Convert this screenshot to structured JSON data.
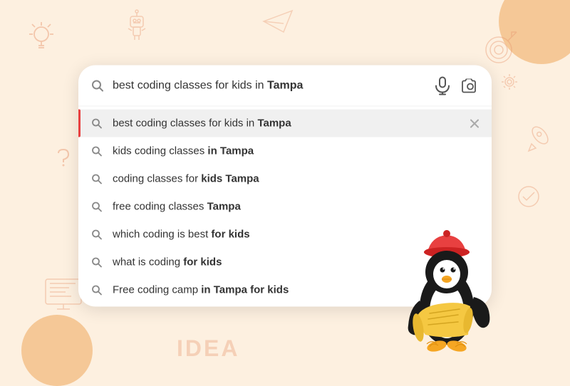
{
  "search": {
    "main_query_text": "best coding classes for kids in ",
    "main_query_bold": "Tampa",
    "mic_aria": "Voice search",
    "camera_aria": "Search by image"
  },
  "suggestions": [
    {
      "id": "s1",
      "text_normal": "best coding classes for kids in ",
      "text_bold": "Tampa",
      "active": true,
      "show_close": true
    },
    {
      "id": "s2",
      "text_normal": "kids coding classes ",
      "text_bold": "in Tampa",
      "active": false,
      "show_close": false
    },
    {
      "id": "s3",
      "text_normal": "coding classes for ",
      "text_bold": "kids Tampa",
      "active": false,
      "show_close": false
    },
    {
      "id": "s4",
      "text_normal": "free coding classes ",
      "text_bold": "Tampa",
      "active": false,
      "show_close": false
    },
    {
      "id": "s5",
      "text_normal": "which coding is best ",
      "text_bold": "for kids",
      "active": false,
      "show_close": false
    },
    {
      "id": "s6",
      "text_normal": "what is coding ",
      "text_bold": "for kids",
      "active": false,
      "show_close": false
    },
    {
      "id": "s7",
      "text_normal": "Free coding camp ",
      "text_bold": "in Tampa for kids",
      "active": false,
      "show_close": false
    }
  ]
}
